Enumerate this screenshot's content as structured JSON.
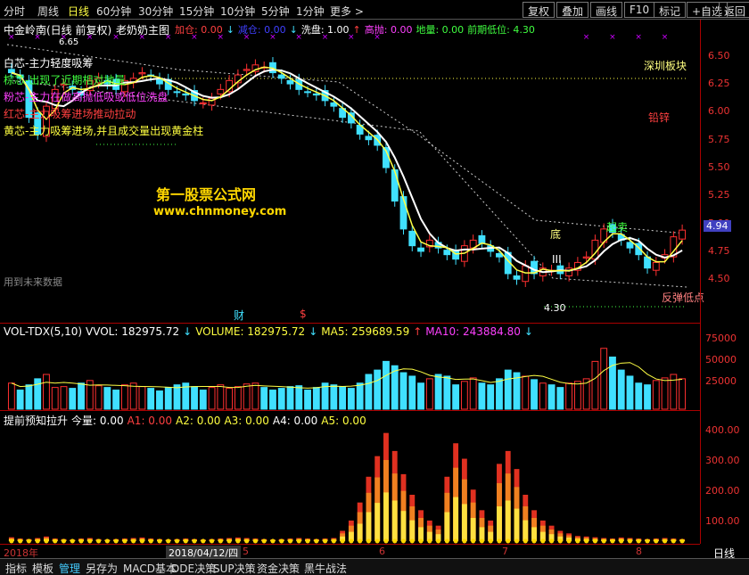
{
  "topbar": {
    "periods": [
      "分时",
      "周线",
      "日线",
      "60分钟",
      "30分钟",
      "15分钟",
      "10分钟",
      "5分钟",
      "1分钟",
      "更多 >"
    ],
    "active_period": "日线",
    "right_buttons": [
      "复权",
      "叠加",
      "画线",
      "F10",
      "标记",
      "+自选",
      "返回"
    ]
  },
  "main": {
    "stock_title": "中金岭南(日线 前复权)",
    "formula": "老奶奶主图",
    "params": [
      {
        "label": "加仓: 0.00",
        "color": "#ff4040"
      },
      {
        "label": "↓",
        "color": "#40e0ff"
      },
      {
        "label": "减仓: 0.00",
        "color": "#4040ff"
      },
      {
        "label": "↓",
        "color": "#40e0ff"
      },
      {
        "label": "洗盘: 1.00",
        "color": "#ffffff"
      },
      {
        "label": "↑",
        "color": "#ff4040"
      },
      {
        "label": "高抛: 0.00",
        "color": "#ff40ff"
      },
      {
        "label": "地量: 0.00",
        "color": "#40ff40"
      },
      {
        "label": "前期低位: 4.30",
        "color": "#40ff40"
      }
    ],
    "high_marker": "6.65",
    "low_marker": "4.30",
    "legend": [
      {
        "text": "白芯-主力轻度吸筹",
        "color": "#ffffff"
      },
      {
        "text": "棕芯-出现了近期相对地量",
        "color": "#40ff40"
      },
      {
        "text": "粉芯-主力在做高抛低吸或低位洗盘",
        "color": "#ff40ff"
      },
      {
        "text": "红芯-主力吸筹进场推动拉动",
        "color": "#ff4040"
      },
      {
        "text": "黄芯-主力吸筹进场,并且成交量出现黄金柱",
        "color": "#ffff40"
      }
    ],
    "sector": "深圳板块",
    "sub_sector": "铅锌",
    "watermark_cn": "第一股票公式网",
    "watermark_url": "www.chnmoney.com",
    "future_note": "用到未来数据",
    "label_di": "底",
    "label_qimai": "起卖",
    "label_rebound": "反弹低点",
    "label_III": "III",
    "label_cai": "财",
    "label_s": "$",
    "current_price": "4.94"
  },
  "volume": {
    "header": [
      {
        "text": "VOL-TDX(5,10)",
        "color": "#ffffff"
      },
      {
        "text": "VVOL: 182975.72",
        "color": "#ffffff"
      },
      {
        "text": "↓",
        "color": "#40e0ff"
      },
      {
        "text": "VOLUME: 182975.72",
        "color": "#ffff40"
      },
      {
        "text": "↓",
        "color": "#40e0ff"
      },
      {
        "text": "MA5: 259689.59",
        "color": "#ffff40"
      },
      {
        "text": "↑",
        "color": "#ff4040"
      },
      {
        "text": "MA10: 243884.80",
        "color": "#ff40ff"
      },
      {
        "text": "↓",
        "color": "#40e0ff"
      }
    ],
    "axis": [
      "75000",
      "50000",
      "25000"
    ]
  },
  "indicator": {
    "header": [
      {
        "text": "提前预知拉升",
        "color": "#ffffff"
      },
      {
        "text": "今量: 0.00",
        "color": "#ffffff"
      },
      {
        "text": "A1: 0.00",
        "color": "#ff4040"
      },
      {
        "text": "A2: 0.00",
        "color": "#ffff40"
      },
      {
        "text": "A3: 0.00",
        "color": "#ffff40"
      },
      {
        "text": "A4: 0.00",
        "color": "#ffffff"
      },
      {
        "text": "A5: 0.00",
        "color": "#ffff40"
      }
    ],
    "axis": [
      "400.00",
      "300.00",
      "200.00",
      "100.00"
    ]
  },
  "price_axis": [
    "6.50",
    "6.25",
    "6.00",
    "5.75",
    "5.50",
    "5.25",
    "5.00",
    "4.75",
    "4.50"
  ],
  "dates": {
    "year": "2018年",
    "selected": "2018/04/12/四",
    "months": [
      "5",
      "6",
      "7",
      "8"
    ]
  },
  "right_period": "日线",
  "bottombar": {
    "tabs": [
      "指标",
      "模板",
      "管理",
      "另存为",
      "MACD基本",
      "DDE决策",
      "SUP决策",
      "资金决策",
      "黑牛战法"
    ],
    "selected_tab": "管理"
  },
  "colors": {
    "up": "#ff3030",
    "down": "#40e0ff",
    "ma_white": "#ffffff",
    "ma_yellow": "#ffff40",
    "frame": "#aa0000"
  },
  "chart_data": {
    "type": "candlestick",
    "price_series": {
      "name": "中金岭南",
      "close": [
        6.35,
        6.3,
        5.95,
        5.8,
        6.05,
        6.2,
        6.25,
        6.2,
        6.15,
        6.28,
        6.3,
        6.25,
        6.2,
        6.28,
        6.3,
        6.35,
        6.32,
        6.25,
        6.2,
        6.18,
        6.15,
        6.1,
        6.08,
        6.12,
        6.2,
        6.28,
        6.33,
        6.38,
        6.42,
        6.4,
        6.35,
        6.3,
        6.25,
        6.2,
        6.18,
        6.15,
        6.1,
        6.05,
        5.95,
        5.9,
        5.8,
        5.75,
        5.7,
        5.5,
        5.2,
        4.95,
        4.8,
        4.75,
        4.85,
        4.78,
        4.72,
        4.68,
        4.8,
        4.85,
        4.82,
        4.75,
        4.7,
        4.55,
        4.5,
        4.62,
        4.55,
        4.6,
        4.58,
        4.55,
        4.6,
        4.65,
        4.7,
        4.85,
        4.95,
        4.92,
        4.85,
        4.78,
        4.72,
        4.6,
        4.65,
        4.72,
        4.88,
        4.94
      ],
      "vol": [
        30,
        22,
        28,
        35,
        40,
        25,
        26,
        24,
        30,
        33,
        27,
        25,
        22,
        28,
        30,
        26,
        24,
        21,
        25,
        28,
        30,
        26,
        22,
        25,
        28,
        24,
        26,
        29,
        30,
        25,
        22,
        24,
        26,
        27,
        22,
        25,
        30,
        28,
        26,
        24,
        30,
        40,
        45,
        55,
        50,
        42,
        38,
        30,
        35,
        40,
        38,
        28,
        32,
        36,
        30,
        28,
        35,
        45,
        42,
        38,
        34,
        30,
        28,
        25,
        30,
        32,
        35,
        55,
        70,
        60,
        45,
        38,
        30,
        28,
        33,
        36,
        40,
        35
      ],
      "ind": [
        15,
        10,
        8,
        12,
        18,
        10,
        8,
        6,
        10,
        12,
        8,
        6,
        8,
        10,
        12,
        14,
        10,
        8,
        6,
        8,
        10,
        8,
        6,
        8,
        10,
        12,
        14,
        12,
        10,
        8,
        6,
        8,
        10,
        12,
        10,
        8,
        10,
        12,
        40,
        80,
        150,
        250,
        330,
        420,
        350,
        260,
        180,
        120,
        80,
        60,
        250,
        380,
        320,
        200,
        120,
        80,
        300,
        350,
        280,
        180,
        120,
        80,
        60,
        40,
        30,
        20,
        18,
        15,
        12,
        10,
        14,
        12,
        10,
        8,
        10,
        12,
        10,
        8
      ]
    }
  }
}
